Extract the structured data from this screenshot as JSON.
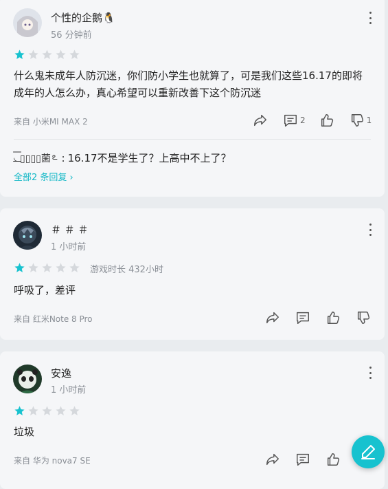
{
  "colors": {
    "accent": "#17c2cf",
    "star_filled": "#17c2cf",
    "star_empty": "#d5d8dc",
    "link": "#14b8c6"
  },
  "reviews": [
    {
      "username": "个性的企鹅🐧",
      "time": "56 分钟前",
      "rating": 1,
      "content": "什么鬼未成年人防沉迷，你们防小学生也就算了，可是我们这些16.17的即将成年的人怎么办，真心希望可以重新改善下这个防沉迷",
      "device": "来自 小米MI MAX 2",
      "comment_count": "2",
      "dislike_count": "1",
      "reply": {
        "deco_left": "◟͟͞͞",
        "name": "▯▯▯▯菌",
        "deco_right": "ఽ",
        "text": "16.17不是学生了？上高中不上了？"
      },
      "reply_link": "全部2 条回复"
    },
    {
      "username": "＃ ＃ ＃",
      "time": "1 小时前",
      "rating": 1,
      "playtime": "游戏时长 432小时",
      "content": "呼吸了，差评",
      "device": "来自 红米Note 8 Pro"
    },
    {
      "username": "安逸",
      "time": "1 小时前",
      "rating": 1,
      "content": "垃圾",
      "device": "来自 华为 nova7 SE"
    }
  ],
  "icons": {
    "share": "share-icon",
    "comment": "comment-icon",
    "like": "thumbs-up-icon",
    "dislike": "thumbs-down-icon",
    "more": "more-vertical-icon",
    "fab": "edit-pen-icon"
  }
}
